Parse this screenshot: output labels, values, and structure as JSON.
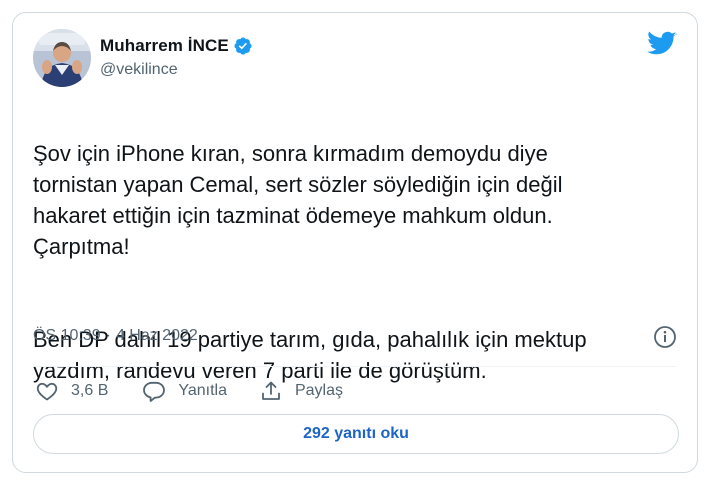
{
  "author": {
    "name": "Muharrem İNCE",
    "handle": "@vekilince",
    "verified": true
  },
  "icons": {
    "verified": "verified-badge-icon",
    "logo": "twitter-bird-icon",
    "info": "info-circle-icon",
    "like": "heart-icon",
    "reply": "speech-bubble-icon",
    "share": "share-upload-icon"
  },
  "tweet": {
    "paragraph_1": "Şov için iPhone kıran, sonra kırmadım demoydu diye\ntornistan yapan Cemal, sert sözler söylediğin için değil\nhakaret ettiğin için tazminat ödemeye mahkum oldun.\nÇarpıtma!",
    "paragraph_2": "Ben DP dahil 19 partiye tarım, gıda, pahalılık için mektup\nyazdım, randevu veren 7 parti ile de görüştüm.",
    "time": "ÖS 10:39",
    "separator": "·",
    "date": "4 Haz 2022"
  },
  "actions": {
    "like_count": "3,6 B",
    "reply_label": "Yanıtla",
    "share_label": "Paylaş"
  },
  "replies_button_label": "292 yanıtı oku",
  "colors": {
    "brand": "#1d9bf0",
    "link": "#1d64c6",
    "secondary_text": "#536471",
    "border": "#cfd9de"
  }
}
